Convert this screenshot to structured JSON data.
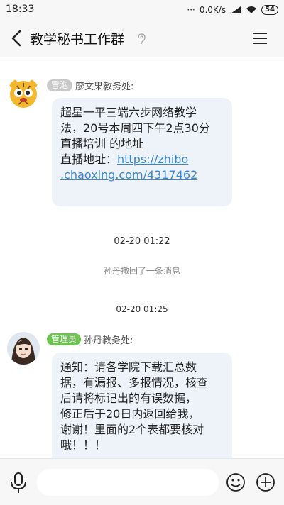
{
  "status_bar": {
    "time": "18:33",
    "network_speed": "0.0K/s",
    "battery": "54"
  },
  "header": {
    "title": "教学秘书工作群"
  },
  "messages": [
    {
      "tag": "冒泡",
      "sender": "廖文果教务处:",
      "lines": [
        "超星一平三端六步网络教学",
        "法，20号本周四下午2点30分",
        "直播培训 的地址"
      ],
      "link_prefix": "直播地址：",
      "link_part1": "https://zhibo",
      "link_part2": ".chaoxing.com/4317462"
    },
    {
      "tag": "管理员",
      "sender": "孙丹教务处:",
      "lines": [
        "通知：请各学院下载汇总数",
        "据，有漏报、多报情况，核查",
        "后请将标记出的有误数据，",
        "修正后于20日内返回给我，",
        "谢谢！里面的2个表都要核对",
        "哦！！！"
      ]
    }
  ],
  "timestamps": [
    "02-20 01:22",
    "02-20 01:25"
  ],
  "system_message": "孙丹撤回了一条消息",
  "colors": {
    "bubble": "#eef3f9",
    "link": "#3a86d6",
    "admin_tag": "#6cc34e",
    "bubble_tag": "#c9c9c9"
  }
}
